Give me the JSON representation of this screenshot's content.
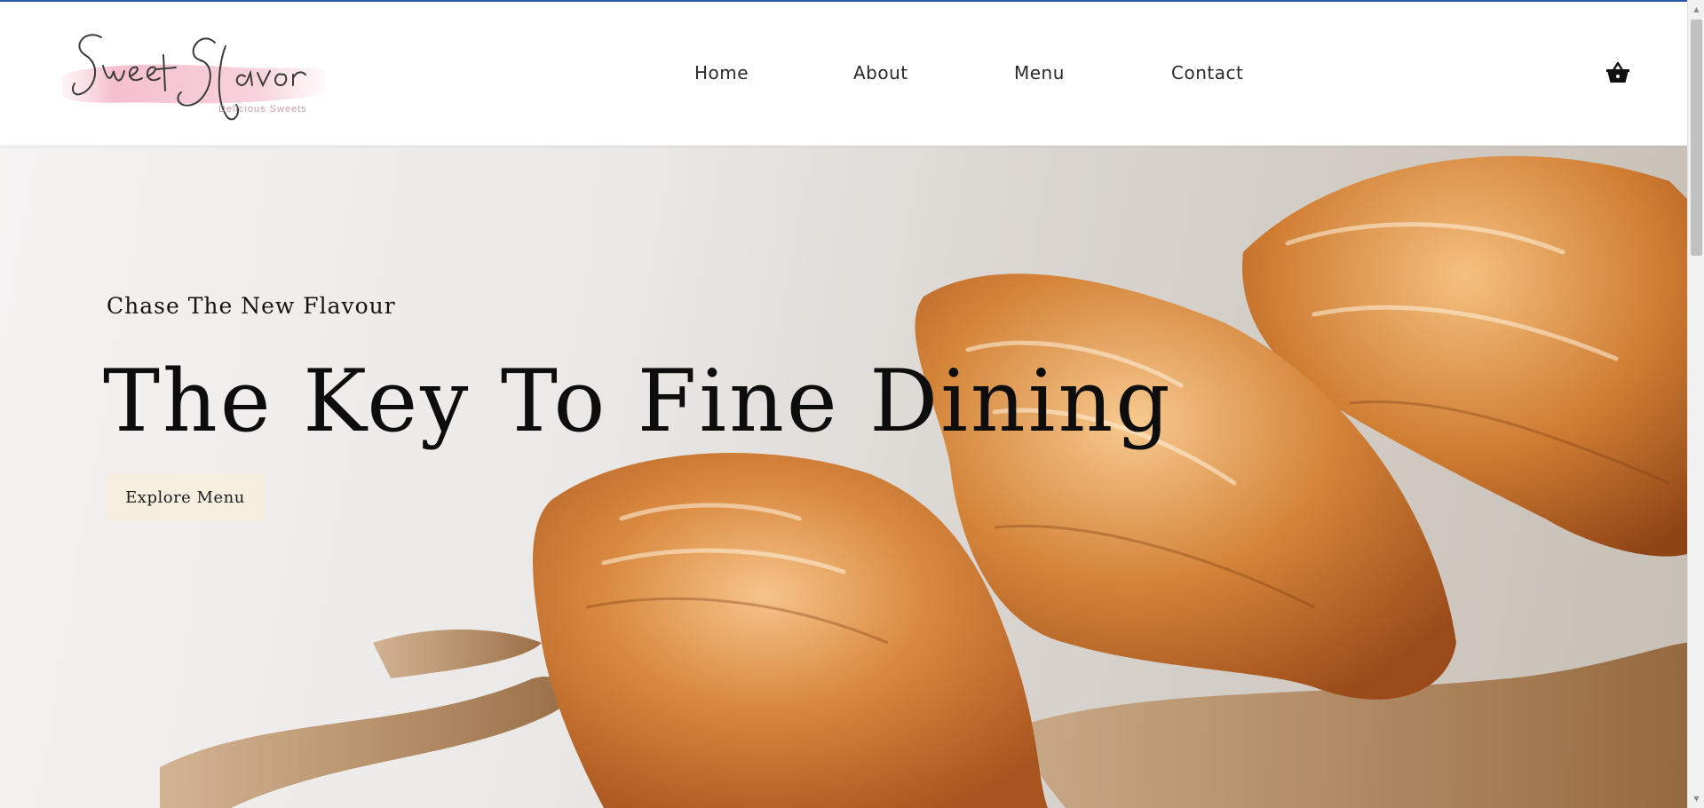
{
  "brand": {
    "name": "Sweet Savor",
    "tagline": "Delicious Sweets"
  },
  "nav": {
    "items": [
      {
        "label": "Home"
      },
      {
        "label": "About"
      },
      {
        "label": "Menu"
      },
      {
        "label": "Contact"
      }
    ],
    "cart_icon": "basket-icon"
  },
  "hero": {
    "subtitle": "Chase The New Flavour",
    "title": "The Key To Fine Dining",
    "button_label": "Explore Menu",
    "background_image": "croissants-with-honey"
  },
  "colors": {
    "accent_line": "#2b5aa6",
    "button_bg": "#f6efe0",
    "logo_wash": "#f1b7c7",
    "text_dark": "#0d0d0d"
  }
}
